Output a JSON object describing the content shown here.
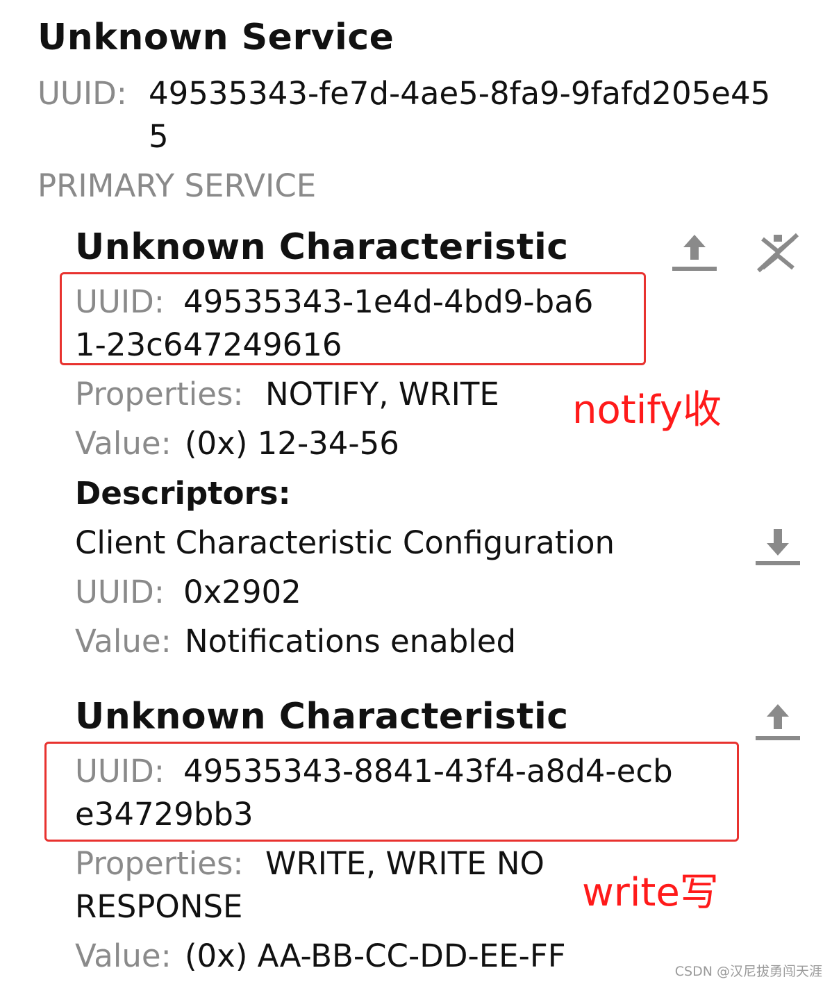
{
  "service": {
    "title": "Unknown Service",
    "uuid_label": "UUID:",
    "uuid_line1": "49535343-fe7d-4ae5-8fa9-9fafd205e45",
    "uuid_line2": "5",
    "type": "PRIMARY SERVICE"
  },
  "characteristics": [
    {
      "title": "Unknown Characteristic",
      "uuid_label": "UUID:",
      "uuid_line1": "49535343-1e4d-4bd9-ba6",
      "uuid_line2": "1-23c647249616",
      "properties_label": "Properties:",
      "properties_line1": "NOTIFY, WRITE",
      "value_label": "Value:",
      "value": "(0x) 12-34-56",
      "annotation": "notify收",
      "descriptors_label": "Descriptors:",
      "descriptor": {
        "name": "Client Characteristic Configuration",
        "uuid_label": "UUID:",
        "uuid": "0x2902",
        "value_label": "Value:",
        "value": "Notifications enabled"
      },
      "icons": [
        "upload-icon",
        "notifications-toggle-icon"
      ]
    },
    {
      "title": "Unknown Characteristic",
      "uuid_label": "UUID:",
      "uuid_line1": "49535343-8841-43f4-a8d4-ecb",
      "uuid_line2": "e34729bb3",
      "properties_label": "Properties:",
      "properties_line1": "WRITE, WRITE NO",
      "properties_line2": "RESPONSE",
      "value_label": "Value:",
      "value": "(0x) AA-BB-CC-DD-EE-FF",
      "annotation": "write写",
      "icons": [
        "upload-icon"
      ]
    }
  ],
  "watermark": "CSDN @汉尼拔勇闯天涯",
  "colors": {
    "annotation_red": "#ff1a1a",
    "box_red": "#e8322f",
    "label_grey": "#8a8a8a",
    "icon_grey": "#8a8a8a"
  }
}
